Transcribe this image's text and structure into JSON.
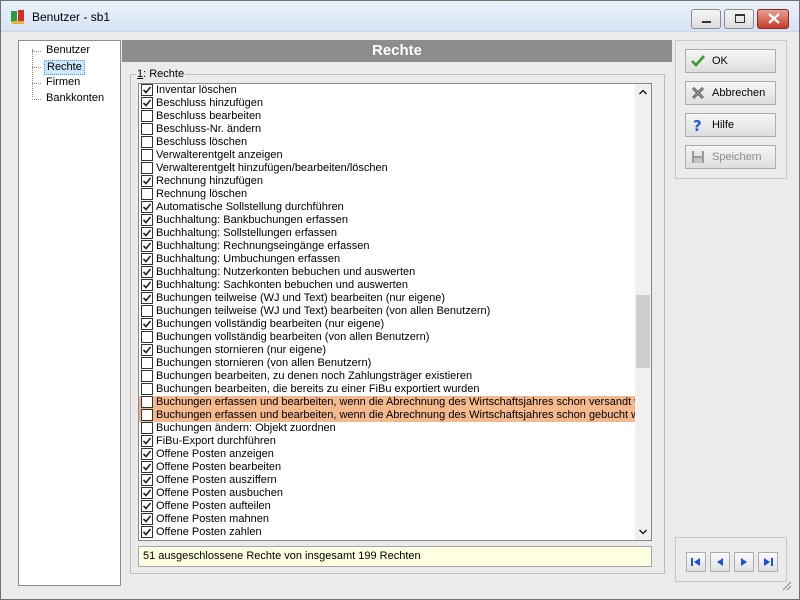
{
  "window": {
    "title": "Benutzer - sb1"
  },
  "tree": {
    "items": [
      {
        "label": "Benutzer",
        "selected": false
      },
      {
        "label": "Rechte",
        "selected": true
      },
      {
        "label": "Firmen",
        "selected": false
      },
      {
        "label": "Bankkonten",
        "selected": false
      }
    ]
  },
  "panel": {
    "header": "Rechte",
    "group_mnemonic": "1",
    "group_label": ": Rechte",
    "rights": [
      {
        "label": "Inventar löschen",
        "checked": true,
        "highlighted": false
      },
      {
        "label": "Beschluss hinzufügen",
        "checked": true,
        "highlighted": false
      },
      {
        "label": "Beschluss bearbeiten",
        "checked": false,
        "highlighted": false
      },
      {
        "label": "Beschluss-Nr. ändern",
        "checked": false,
        "highlighted": false
      },
      {
        "label": "Beschluss löschen",
        "checked": false,
        "highlighted": false
      },
      {
        "label": "Verwalterentgelt anzeigen",
        "checked": false,
        "highlighted": false
      },
      {
        "label": "Verwalterentgelt hinzufügen/bearbeiten/löschen",
        "checked": false,
        "highlighted": false
      },
      {
        "label": "Rechnung hinzufügen",
        "checked": true,
        "highlighted": false
      },
      {
        "label": "Rechnung löschen",
        "checked": false,
        "highlighted": false
      },
      {
        "label": "Automatische Sollstellung durchführen",
        "checked": true,
        "highlighted": false
      },
      {
        "label": "Buchhaltung: Bankbuchungen erfassen",
        "checked": true,
        "highlighted": false
      },
      {
        "label": "Buchhaltung: Sollstellungen erfassen",
        "checked": true,
        "highlighted": false
      },
      {
        "label": "Buchhaltung: Rechnungseingänge erfassen",
        "checked": true,
        "highlighted": false
      },
      {
        "label": "Buchhaltung: Umbuchungen erfassen",
        "checked": true,
        "highlighted": false
      },
      {
        "label": "Buchhaltung: Nutzerkonten bebuchen und auswerten",
        "checked": true,
        "highlighted": false
      },
      {
        "label": "Buchhaltung: Sachkonten bebuchen und auswerten",
        "checked": true,
        "highlighted": false
      },
      {
        "label": "Buchungen teilweise (WJ und Text) bearbeiten (nur eigene)",
        "checked": true,
        "highlighted": false
      },
      {
        "label": "Buchungen teilweise (WJ und Text) bearbeiten (von allen Benutzern)",
        "checked": false,
        "highlighted": false
      },
      {
        "label": "Buchungen vollständig bearbeiten (nur eigene)",
        "checked": true,
        "highlighted": false
      },
      {
        "label": "Buchungen vollständig bearbeiten (von allen Benutzern)",
        "checked": false,
        "highlighted": false
      },
      {
        "label": "Buchungen stornieren (nur eigene)",
        "checked": true,
        "highlighted": false
      },
      {
        "label": "Buchungen stornieren (von allen Benutzern)",
        "checked": false,
        "highlighted": false
      },
      {
        "label": "Buchungen bearbeiten, zu denen noch Zahlungsträger existieren",
        "checked": false,
        "highlighted": false
      },
      {
        "label": "Buchungen bearbeiten, die bereits zu einer FiBu exportiert wurden",
        "checked": false,
        "highlighted": false
      },
      {
        "label": "Buchungen erfassen und bearbeiten, wenn die Abrechnung des Wirtschaftsjahres schon versandt wu",
        "checked": false,
        "highlighted": true
      },
      {
        "label": "Buchungen erfassen und bearbeiten, wenn die Abrechnung des Wirtschaftsjahres schon gebucht wu",
        "checked": false,
        "highlighted": true
      },
      {
        "label": "Buchungen ändern: Objekt zuordnen",
        "checked": false,
        "highlighted": false
      },
      {
        "label": "FiBu-Export durchführen",
        "checked": true,
        "highlighted": false
      },
      {
        "label": "Offene Posten anzeigen",
        "checked": true,
        "highlighted": false
      },
      {
        "label": "Offene Posten bearbeiten",
        "checked": true,
        "highlighted": false
      },
      {
        "label": "Offene Posten ausziffern",
        "checked": true,
        "highlighted": false
      },
      {
        "label": "Offene Posten ausbuchen",
        "checked": true,
        "highlighted": false
      },
      {
        "label": "Offene Posten aufteilen",
        "checked": true,
        "highlighted": false
      },
      {
        "label": "Offene Posten mahnen",
        "checked": true,
        "highlighted": false
      },
      {
        "label": "Offene Posten zahlen",
        "checked": true,
        "highlighted": false
      }
    ],
    "status": "51 ausgeschlossene Rechte von insgesamt 199 Rechten"
  },
  "buttons": {
    "ok": "OK",
    "cancel": "Abbrechen",
    "help": "Hilfe",
    "save": "Speichern"
  },
  "colors": {
    "header_bg": "#8c8c8c",
    "highlight_row": "#f5b98e",
    "status_bg": "#ffffe1",
    "nav_blue": "#1d4fd8"
  }
}
